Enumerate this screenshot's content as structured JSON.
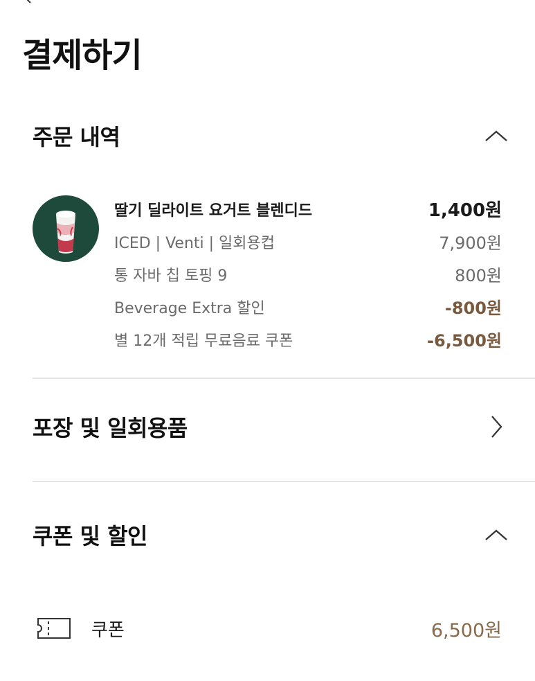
{
  "page": {
    "title": "결제하기"
  },
  "order_section": {
    "title": "주문 내역",
    "items": [
      {
        "label": "딸기 딜라이트 요거트 블렌디드",
        "price": "1,400원"
      },
      {
        "label": "ICED | Venti | 일회용컵",
        "price": "7,900원"
      },
      {
        "label": "통 자바 칩 토핑 9",
        "price": "800원"
      },
      {
        "label": "Beverage Extra 할인",
        "price": "-800원"
      },
      {
        "label": "별 12개 적립 무료음료 쿠폰",
        "price": "-6,500원"
      }
    ]
  },
  "packaging_section": {
    "title": "포장 및 일회용품"
  },
  "coupon_section": {
    "title": "쿠폰 및 할인",
    "coupon_label": "쿠폰",
    "coupon_value": "6,500원"
  },
  "icons": {
    "back": "chevron-left-icon",
    "collapse": "chevron-up-icon",
    "navigate": "chevron-right-icon",
    "coupon": "ticket-icon"
  },
  "colors": {
    "discount": "#7a5a3e",
    "coupon_value": "#8a6a4a",
    "product_bg": "#1e4a3c",
    "divider": "#e3e3e3"
  }
}
